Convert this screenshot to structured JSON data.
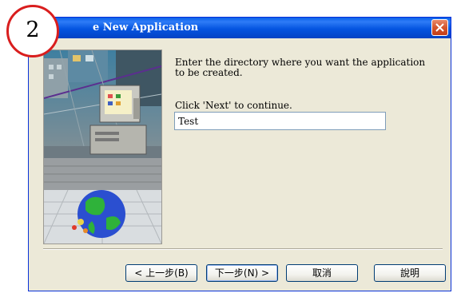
{
  "window": {
    "title": "e New Application",
    "instructions": "Enter the directory where you want the application to be created.",
    "continue_prompt": "Click 'Next' to continue.",
    "directory_value": "Test"
  },
  "buttons": {
    "back": "< 上一步(B)",
    "next": "下一步(N) >",
    "cancel": "取消",
    "help": "說明"
  },
  "annotation": {
    "step_number": "2"
  },
  "colors": {
    "titlebar": "#0454e0",
    "close_button": "#d4562e",
    "dialog_bg": "#ece9d8",
    "annotation_circle": "#d91e1e"
  },
  "icons": [
    "close-icon",
    "wizard-art-computer-globe"
  ]
}
